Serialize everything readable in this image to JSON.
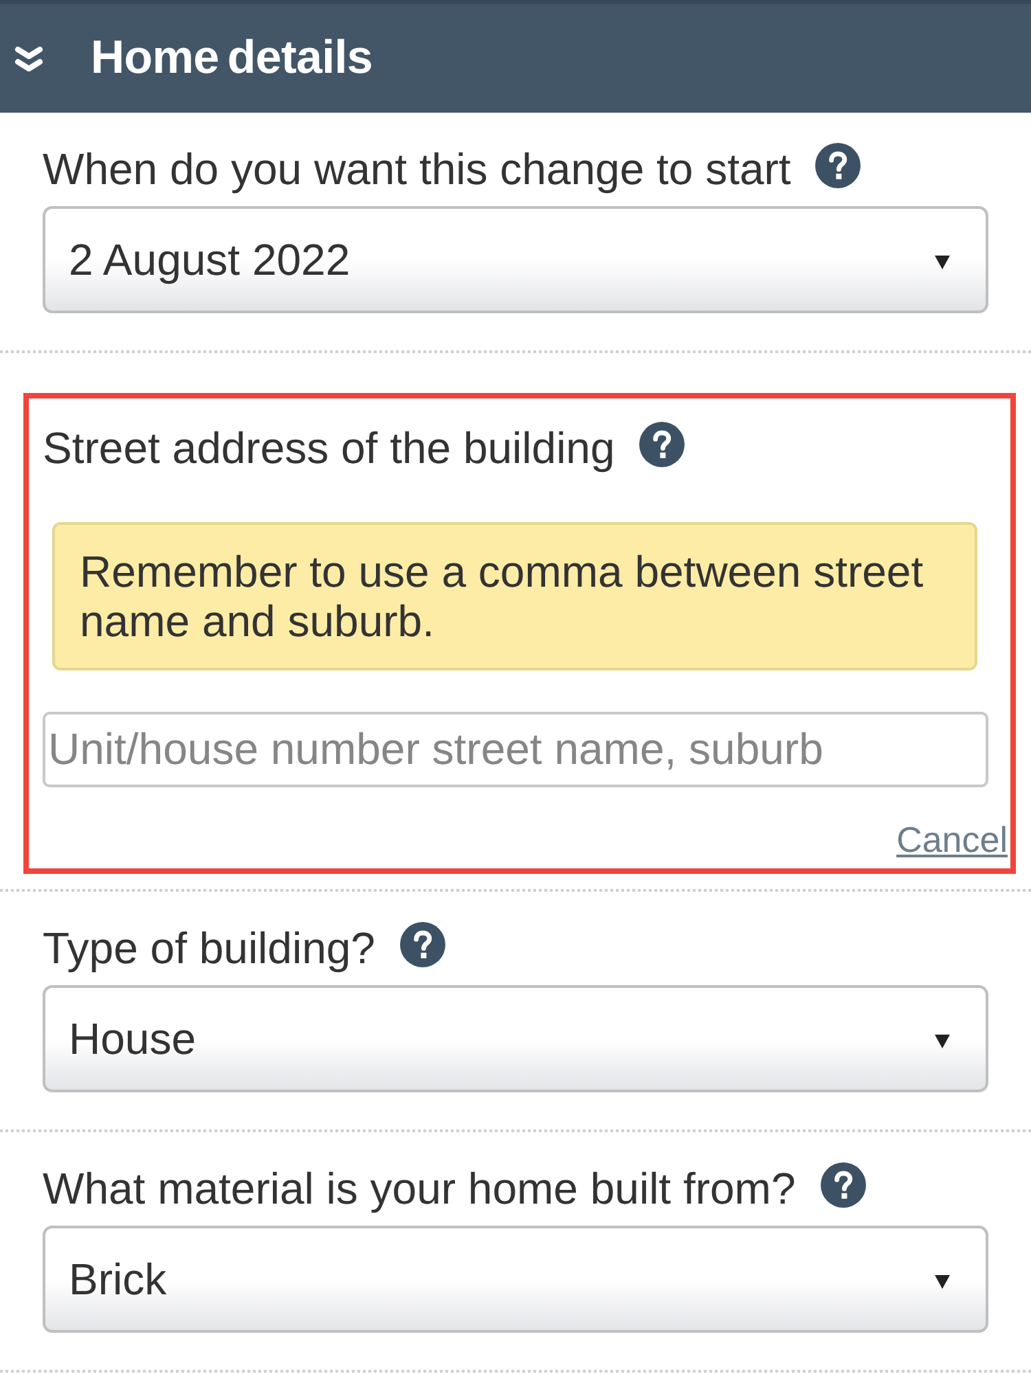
{
  "header": {
    "title": "Home details"
  },
  "fields": [
    {
      "kind": "select",
      "label": "When do you want this change to start",
      "value": "2 August 2022",
      "highlighted": false
    },
    {
      "kind": "address",
      "label": "Street address of the building",
      "highlighted": true,
      "note": "Remember to use a comma between street name and suburb.",
      "placeholder": "Unit/house number street name, suburb",
      "link": "Cancel"
    },
    {
      "kind": "select",
      "label": "Type of building?",
      "value": "House",
      "highlighted": false
    },
    {
      "kind": "select",
      "label": "What material is your home built from?",
      "value": "Brick",
      "highlighted": false
    }
  ]
}
